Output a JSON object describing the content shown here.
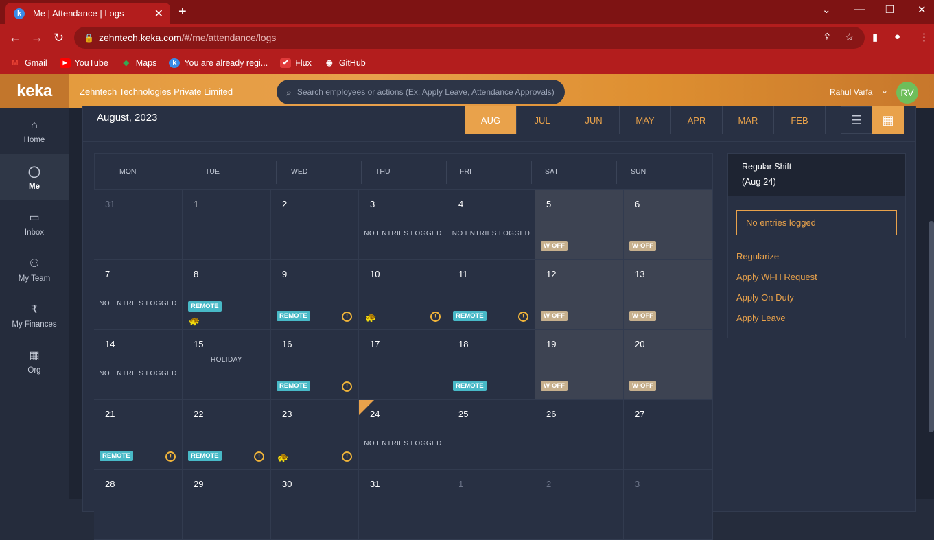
{
  "browser": {
    "tab_title": "Me | Attendance | Logs",
    "tab_favicon": "k",
    "url_host": "zehntech.keka.com",
    "url_path": "/#/me/attendance/logs",
    "bookmarks": [
      {
        "label": "Gmail",
        "icon": "M"
      },
      {
        "label": "YouTube",
        "icon": "▶"
      },
      {
        "label": "Maps",
        "icon": "◆"
      },
      {
        "label": "You are already regi...",
        "icon": "k"
      },
      {
        "label": "Flux",
        "icon": "✔"
      },
      {
        "label": "GitHub",
        "icon": "◉"
      }
    ]
  },
  "header": {
    "logo": "keka",
    "company": "Zehntech Technologies Private Limited",
    "search_placeholder": "Search employees or actions (Ex: Apply Leave, Attendance Approvals)",
    "user_name": "Rahul Varfa",
    "avatar_initials": "RV"
  },
  "sidebar": {
    "items": [
      {
        "label": "Home",
        "icon": "⌂"
      },
      {
        "label": "Me",
        "icon": "◯"
      },
      {
        "label": "Inbox",
        "icon": "▭"
      },
      {
        "label": "My Team",
        "icon": "⚇"
      },
      {
        "label": "My Finances",
        "icon": "₹"
      },
      {
        "label": "Org",
        "icon": "▦"
      }
    ]
  },
  "calendar": {
    "title": "August, 2023",
    "months": [
      "AUG",
      "JUL",
      "JUN",
      "MAY",
      "APR",
      "MAR",
      "FEB"
    ],
    "days": [
      "MON",
      "TUE",
      "WED",
      "THU",
      "FRI",
      "SAT",
      "SUN"
    ],
    "cells": [
      {
        "day": "31",
        "dim": true
      },
      {
        "day": "1"
      },
      {
        "day": "2"
      },
      {
        "day": "3",
        "note": "NO ENTRIES LOGGED"
      },
      {
        "day": "4",
        "note": "NO ENTRIES LOGGED"
      },
      {
        "day": "5",
        "weekend": true,
        "badge": "W-OFF"
      },
      {
        "day": "6",
        "weekend": true,
        "badge": "W-OFF"
      },
      {
        "day": "7",
        "note": "NO ENTRIES LOGGED"
      },
      {
        "day": "8",
        "badge": "REMOTE",
        "turtle": true
      },
      {
        "day": "9",
        "badge": "REMOTE",
        "warn": true
      },
      {
        "day": "10",
        "turtle": true,
        "warn": true
      },
      {
        "day": "11",
        "badge": "REMOTE",
        "warn": true
      },
      {
        "day": "12",
        "weekend": true,
        "badge": "W-OFF"
      },
      {
        "day": "13",
        "weekend": true,
        "badge": "W-OFF"
      },
      {
        "day": "14",
        "note": "NO ENTRIES LOGGED"
      },
      {
        "day": "15",
        "note": "HOLIDAY",
        "holiday": true
      },
      {
        "day": "16",
        "badge": "REMOTE",
        "warn": true
      },
      {
        "day": "17"
      },
      {
        "day": "18",
        "badge": "REMOTE"
      },
      {
        "day": "19",
        "weekend": true,
        "badge": "W-OFF"
      },
      {
        "day": "20",
        "weekend": true,
        "badge": "W-OFF"
      },
      {
        "day": "21",
        "badge": "REMOTE",
        "warn": true
      },
      {
        "day": "22",
        "badge": "REMOTE",
        "warn": true
      },
      {
        "day": "23",
        "turtle": true,
        "warn": true
      },
      {
        "day": "24",
        "note": "NO ENTRIES LOGGED",
        "today": true
      },
      {
        "day": "25"
      },
      {
        "day": "26"
      },
      {
        "day": "27"
      },
      {
        "day": "28"
      },
      {
        "day": "29"
      },
      {
        "day": "30"
      },
      {
        "day": "31"
      },
      {
        "day": "1",
        "dim": true
      },
      {
        "day": "2",
        "dim": true
      },
      {
        "day": "3",
        "dim": true
      }
    ]
  },
  "shift": {
    "title": "Regular Shift",
    "date": "(Aug 24)",
    "status": "No entries logged",
    "actions": [
      "Regularize",
      "Apply WFH Request",
      "Apply On Duty",
      "Apply Leave"
    ]
  },
  "colors": {
    "accent": "#e9a24b",
    "remote": "#48b9c7",
    "woff": "#c7b08d",
    "chrome": "#b31d1d"
  }
}
